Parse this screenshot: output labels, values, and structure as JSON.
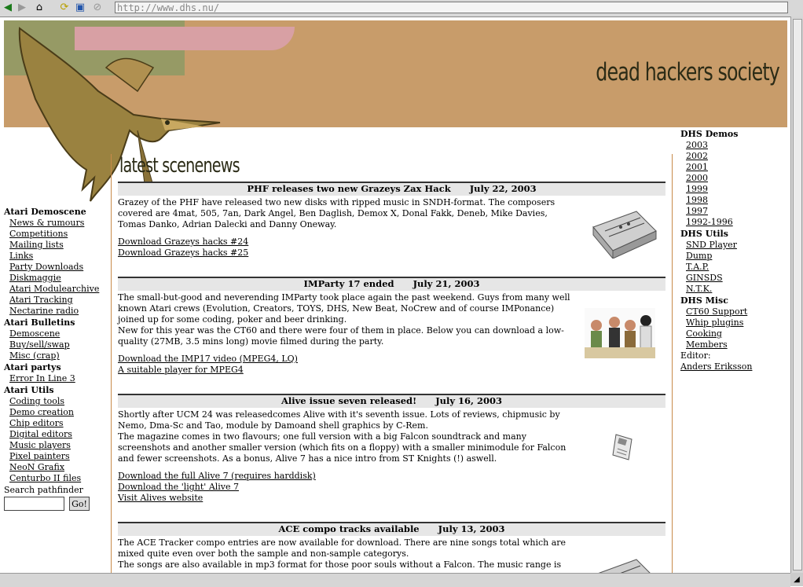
{
  "browser": {
    "url": "http://www.dhs.nu/",
    "icons": [
      "back-icon",
      "forward-icon",
      "home-icon",
      "reload-icon",
      "open-icon",
      "stop-icon"
    ]
  },
  "site": {
    "title": "dead hackers society",
    "news_heading": "latest scenenews"
  },
  "left_nav": {
    "sections": [
      {
        "title": "Atari Demoscene",
        "items": [
          "News & rumours",
          "Competitions",
          "Mailing lists",
          "Links",
          "Party Downloads",
          "Diskmaggie",
          "Atari Modulearchive",
          "Atari Tracking",
          "Nectarine radio"
        ]
      },
      {
        "title": "Atari Bulletins",
        "items": [
          "Demoscene",
          "Buy/sell/swap",
          "Misc (crap)"
        ]
      },
      {
        "title": "Atari partys",
        "items": [
          "Error In Line 3"
        ]
      },
      {
        "title": "Atari Utils",
        "items": [
          "Coding tools",
          "Demo creation",
          "Chip editors",
          "Digital editors",
          "Music players",
          "Pixel painters",
          "NeoN Grafix",
          "Centurbo II files"
        ]
      }
    ],
    "search_label": "Search pathfinder",
    "search_button": "Go!"
  },
  "news": [
    {
      "headline": "PHF releases two new Grazeys Zax Hack",
      "date": "July 22, 2003",
      "paragraphs": [
        "Grazey of the PHF have released two new disks with ripped music in SNDH-format. The composers covered are 4mat, 505, 7an, Dark Angel, Ben Daglish, Demox X, Donal Fakk, Deneb, Mike Davies, Tomas Danko, Adrian Dalecki and Danny Oneway."
      ],
      "links": [
        "Download Grazeys hacks #24",
        "Download Grazeys hacks #25"
      ]
    },
    {
      "headline": "IMParty 17 ended",
      "date": "July 21, 2003",
      "paragraphs": [
        "The small-but-good and neverending IMParty took place again the past weekend. Guys from many well known Atari crews (Evolution, Creators, TOYS, DHS, New Beat, NoCrew and of course IMPonance) joined up for some coding, poker and beer drinking.",
        "New for this year was the CT60 and there were four of them in place. Below you can download a low-quality (27MB, 3.5 mins long) movie filmed during the party."
      ],
      "links": [
        "Download the IMP17 video (MPEG4, LQ)",
        "A suitable player for MPEG4"
      ]
    },
    {
      "headline": "Alive issue seven released!",
      "date": "July 16, 2003",
      "paragraphs": [
        "Shortly after UCM 24 was releasedcomes Alive with it's seventh issue. Lots of reviews, chipmusic by Nemo, Dma-Sc and Tao, module by Damoand shell graphics by C-Rem.",
        "The magazine comes in two flavours; one full version with a big Falcon soundtrack and many screenshots and another smaller version (which fits on a floppy) with a smaller minimodule for Falcon and fewer screenshots. As a bonus, Alive 7 has a nice intro from ST Knights (!) aswell."
      ],
      "links": [
        "Download the full Alive 7 (requires harddisk)",
        "Download the 'light' Alive 7",
        "Visit Alives website"
      ]
    },
    {
      "headline": "ACE compo tracks available",
      "date": "July 13, 2003",
      "paragraphs": [
        "The ACE Tracker compo entries are now available for download. There are nine songs total which are mixed quite even over both the sample and non-sample categorys.",
        "The songs are also available in mp3 format for those poor souls without a Falcon. The music range is"
      ],
      "links": []
    }
  ],
  "right_nav": {
    "sections": [
      {
        "title": "DHS Demos",
        "items": [
          "2003",
          "2002",
          "2001",
          "2000",
          "1999",
          "1998",
          "1997",
          "1992-1996"
        ]
      },
      {
        "title": "DHS Utils",
        "items": [
          "SND Player",
          "Dump",
          "T.A.P.",
          "GINSDS",
          "N.T.K."
        ]
      },
      {
        "title": "DHS Misc",
        "items": [
          "CT60 Support",
          "Whip plugins",
          "Cooking",
          "Members"
        ]
      }
    ],
    "editor_label": "Editor:",
    "editor_name": "Anders Eriksson"
  }
}
